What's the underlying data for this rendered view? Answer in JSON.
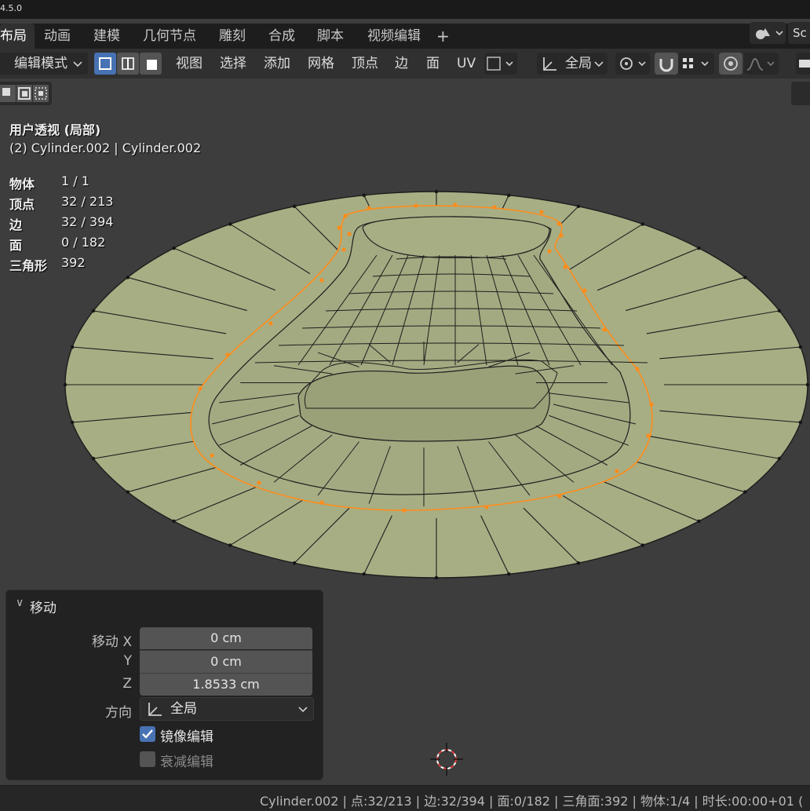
{
  "app": {
    "version": "4.5.0"
  },
  "workspace_tabs": [
    {
      "label": "布局"
    },
    {
      "label": "动画"
    },
    {
      "label": "建模"
    },
    {
      "label": "几何节点"
    },
    {
      "label": "雕刻"
    },
    {
      "label": "合成"
    },
    {
      "label": "脚本"
    },
    {
      "label": "视频编辑"
    }
  ],
  "scene_field": "Sc",
  "header": {
    "mode": "编辑模式",
    "menus": [
      "视图",
      "选择",
      "添加",
      "网格",
      "顶点",
      "边",
      "面",
      "UV"
    ],
    "transform_orientation": "全局"
  },
  "viewport": {
    "view_name": "用户透视 (局部)",
    "object_info": "(2) Cylinder.002 | Cylinder.002",
    "stats": [
      {
        "label": "物体",
        "value": "1 / 1"
      },
      {
        "label": "顶点",
        "value": "32 / 213"
      },
      {
        "label": "边",
        "value": "32 / 394"
      },
      {
        "label": "面",
        "value": "0 / 182"
      },
      {
        "label": "三角形",
        "value": "392"
      }
    ]
  },
  "operator_panel": {
    "title": "移动",
    "move_x_label": "移动 X",
    "move_x": "0 cm",
    "y_label": "Y",
    "move_y": "0 cm",
    "z_label": "Z",
    "move_z": "1.8533 cm",
    "orientation_label": "方向",
    "orientation_value": "全局",
    "mirror_label": "镜像编辑",
    "mirror_checked": true,
    "proportional_label": "衰减编辑",
    "proportional_checked": false
  },
  "statusbar": {
    "text": "Cylinder.002 | 点:32/213 | 边:32/394 | 面:0/182 | 三角面:392 | 物体:1/4 | 时长:00:00+01 ("
  },
  "colors": {
    "mesh_face": "#a7ae84",
    "selection": "#ff8c1a",
    "accent_blue": "#4772b3"
  }
}
